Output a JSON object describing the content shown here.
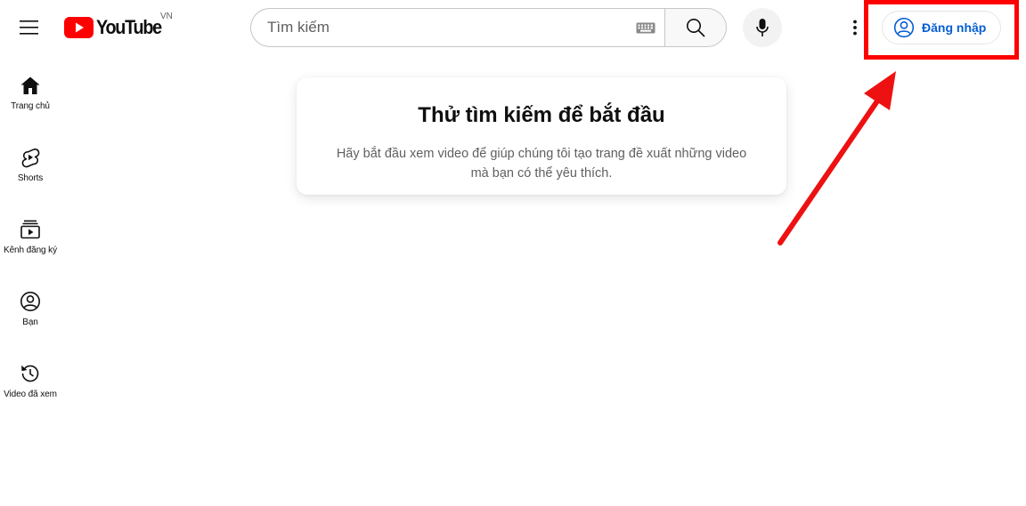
{
  "header": {
    "logo_text": "YouTube",
    "country_code": "VN",
    "search_placeholder": "Tìm kiếm",
    "signin_label": "Đăng nhập"
  },
  "sidebar": {
    "items": [
      {
        "label": "Trang chủ",
        "icon": "home-icon"
      },
      {
        "label": "Shorts",
        "icon": "shorts-icon"
      },
      {
        "label": "Kênh đăng ký",
        "icon": "subscriptions-icon"
      },
      {
        "label": "Bạn",
        "icon": "you-icon"
      },
      {
        "label": "Video đã xem",
        "icon": "history-icon"
      }
    ]
  },
  "main": {
    "card_title": "Thử tìm kiếm để bắt đầu",
    "card_text": "Hãy bắt đầu xem video để giúp chúng tôi tạo trang đề xuất những video mà bạn có thể yêu thích."
  },
  "colors": {
    "brand_red": "#ff0000",
    "link_blue": "#065fd4",
    "annotation_red": "#ff0000"
  }
}
